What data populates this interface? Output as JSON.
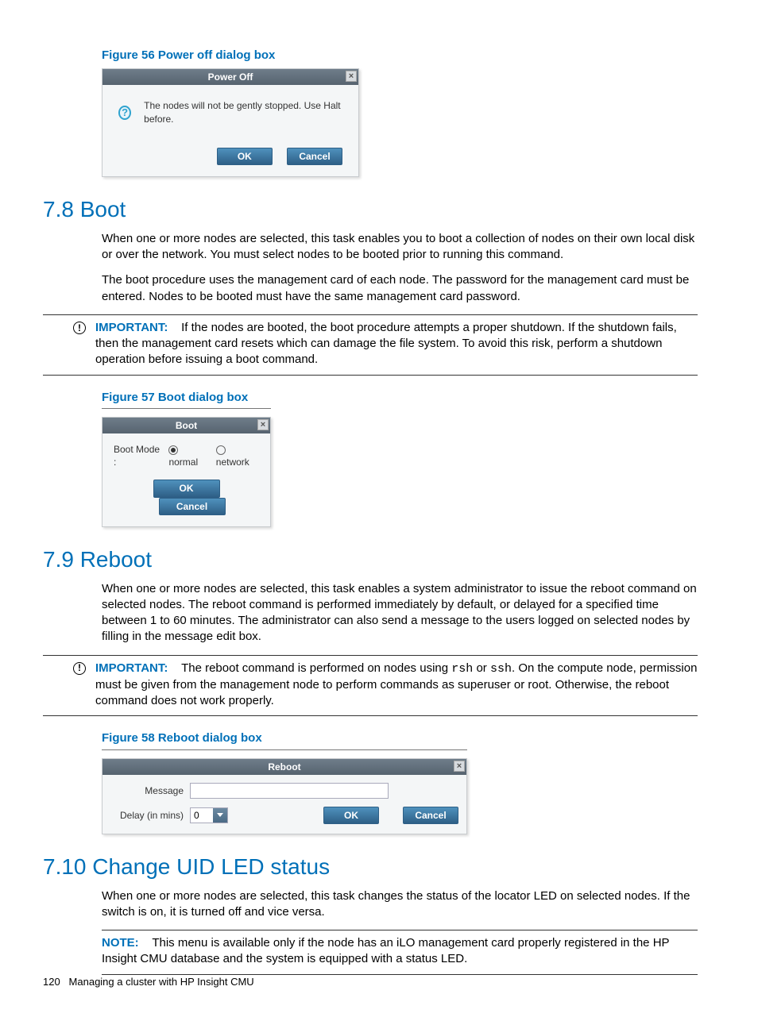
{
  "figure56": {
    "caption": "Figure 56 Power off dialog box",
    "title": "Power Off",
    "message": "The nodes will not be gently stopped. Use Halt before.",
    "ok": "OK",
    "cancel": "Cancel"
  },
  "sec78": {
    "heading": "7.8 Boot",
    "p1": "When one or more nodes are selected, this task enables you to boot a collection of nodes on their own local disk or over the network. You must select nodes to be booted prior to running this command.",
    "p2": "The boot procedure uses the management card of each node. The password for the management card must be entered. Nodes to be booted must have the same management card password.",
    "important_label": "IMPORTANT:",
    "important_text": "If the nodes are booted, the boot procedure attempts a proper shutdown. If the shutdown fails, then the management card resets which can damage the file system. To avoid this risk, perform a shutdown operation before issuing a boot command."
  },
  "figure57": {
    "caption": "Figure 57 Boot dialog box",
    "title": "Boot",
    "mode_label": "Boot Mode :",
    "opt_normal": "normal",
    "opt_network": "network",
    "ok": "OK",
    "cancel": "Cancel"
  },
  "sec79": {
    "heading": "7.9 Reboot",
    "p1": "When one or more nodes are selected, this task enables a system administrator to issue the reboot command on selected nodes. The reboot command is performed immediately by default, or delayed for a specified time between 1 to 60 minutes. The administrator can also send a message to the users logged on selected nodes by filling in the message edit box.",
    "important_label": "IMPORTANT:",
    "important_text_a": "The reboot command is performed on nodes using ",
    "important_code1": "rsh",
    "important_text_b": " or ",
    "important_code2": "ssh",
    "important_text_c": ". On the compute node, permission must be given from the management node to perform commands as superuser or root. Otherwise, the reboot command does not work properly."
  },
  "figure58": {
    "caption": "Figure 58 Reboot dialog box",
    "title": "Reboot",
    "message_label": "Message",
    "delay_label": "Delay (in mins)",
    "delay_value": "0",
    "ok": "OK",
    "cancel": "Cancel"
  },
  "sec710": {
    "heading": "7.10 Change UID LED status",
    "p1": "When one or more nodes are selected, this task changes the status of the locator LED on selected nodes. If the switch is on, it is turned off and vice versa.",
    "note_label": "NOTE:",
    "note_text": "This menu is available only if the node has an iLO management card properly registered in the HP Insight CMU database and the system is equipped with a status LED."
  },
  "footer": {
    "page": "120",
    "chapter": "Managing a cluster with HP Insight CMU"
  }
}
